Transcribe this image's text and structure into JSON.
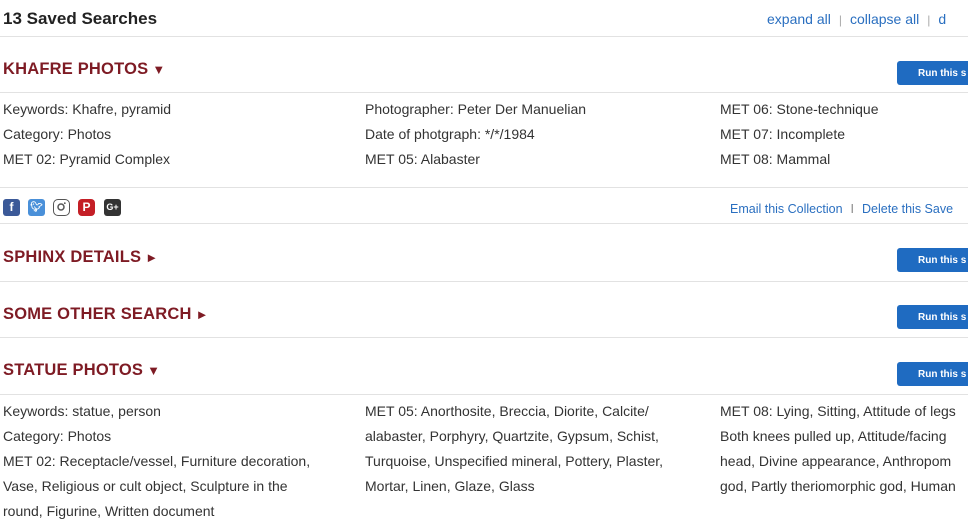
{
  "header": {
    "title": "13 Saved Searches",
    "expand_all": "expand all",
    "collapse_all": "collapse all",
    "truncated_action": "d",
    "separator": "|"
  },
  "run_button_label": "Run this s",
  "sections": [
    {
      "title": "KHAFRE PHOTOS",
      "arrow": "▼",
      "expanded": true,
      "columns": [
        [
          "Keywords: Khafre, pyramid",
          "Category: Photos",
          "MET 02: Pyramid Complex"
        ],
        [
          "Photographer: Peter Der Manuelian",
          "Date of photgraph: */*/1984",
          "MET 05: Alabaster"
        ],
        [
          "MET 06: Stone-technique",
          "MET 07: Incomplete",
          "MET 08: Mammal"
        ]
      ],
      "share": {
        "icons": [
          "facebook-icon",
          "twitter-icon",
          "instagram-icon",
          "pinterest-icon",
          "google-plus-icon"
        ],
        "email": "Email this Collection",
        "delete": "Delete this Save",
        "separator": "I"
      }
    },
    {
      "title": "SPHINX DETAILS",
      "arrow": "►",
      "expanded": false
    },
    {
      "title": "SOME OTHER SEARCH",
      "arrow": "►",
      "expanded": false
    },
    {
      "title": "STATUE PHOTOS",
      "arrow": "▼",
      "expanded": true,
      "columns": [
        [
          "Keywords: statue, person",
          "Category: Photos",
          "MET 02: Receptacle/vessel, Furniture decoration,",
          "Vase, Religious or cult object, Sculpture in the",
          "round, Figurine, Written document"
        ],
        [
          "MET 05: Anorthosite, Breccia, Diorite, Calcite/",
          "alabaster, Porphyry, Quartzite, Gypsum, Schist,",
          "Turquoise, Unspecified mineral, Pottery, Plaster,",
          "Mortar, Linen, Glaze, Glass"
        ],
        [
          "MET 08: Lying, Sitting, Attitude of legs",
          "Both knees pulled up, Attitude/facing",
          "head, Divine appearance, Anthropom",
          "god, Partly theriomorphic god, Human"
        ]
      ]
    }
  ],
  "colors": {
    "section_title": "#7e1b24",
    "button": "#1f6bc1",
    "link": "#2a6fc0"
  }
}
